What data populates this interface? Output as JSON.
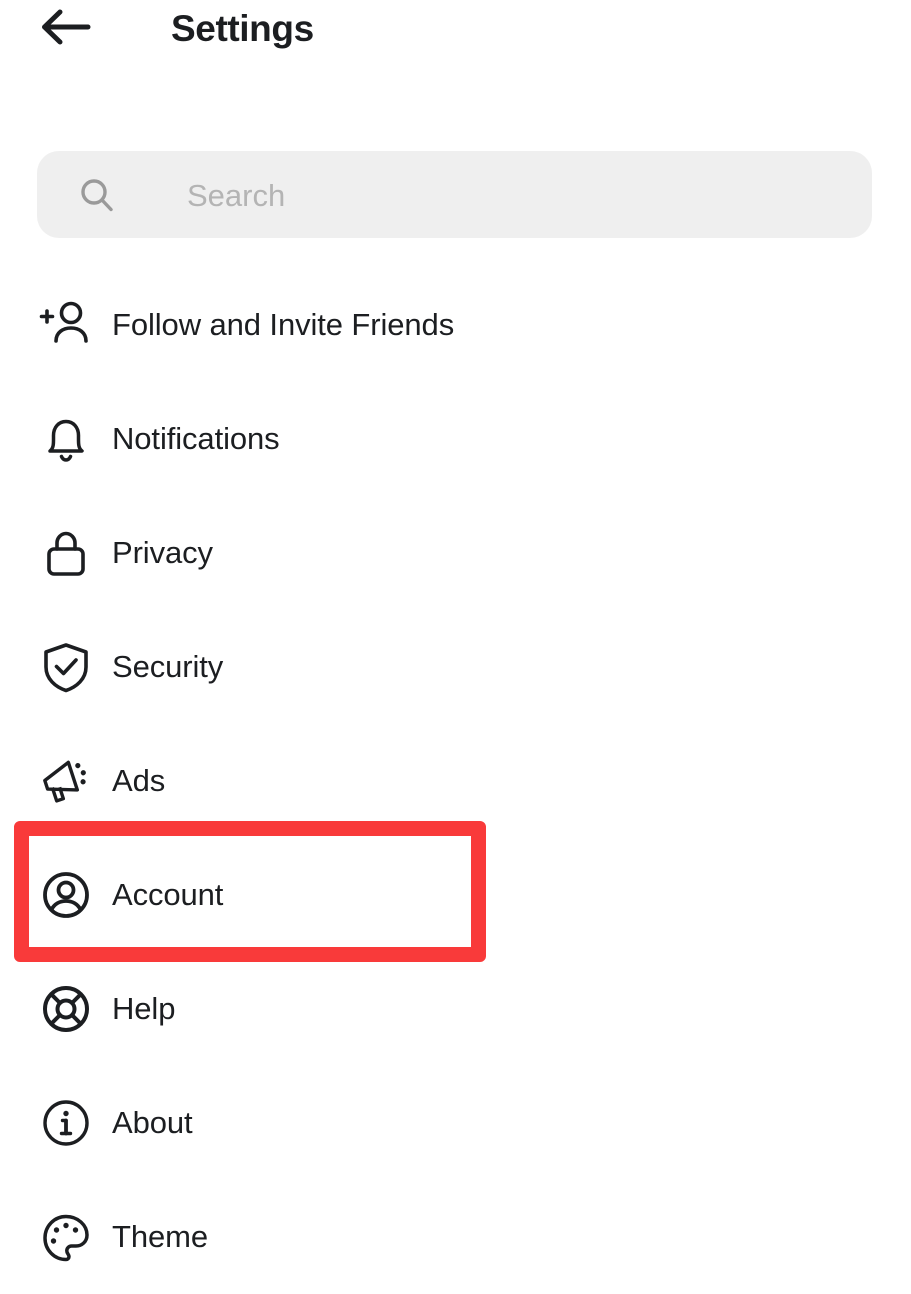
{
  "header": {
    "title": "Settings",
    "back_icon": "arrow-left-icon"
  },
  "search": {
    "placeholder": "Search",
    "value": "",
    "icon": "search-icon",
    "background_color": "#EFEFEF",
    "placeholder_color": "#B4B4B4"
  },
  "menu": {
    "items": [
      {
        "label": "Follow and Invite Friends",
        "icon": "person-add-icon"
      },
      {
        "label": "Notifications",
        "icon": "bell-icon"
      },
      {
        "label": "Privacy",
        "icon": "lock-icon"
      },
      {
        "label": "Security",
        "icon": "shield-check-icon"
      },
      {
        "label": "Ads",
        "icon": "megaphone-icon"
      },
      {
        "label": "Account",
        "icon": "account-circle-icon"
      },
      {
        "label": "Help",
        "icon": "life-ring-icon"
      },
      {
        "label": "About",
        "icon": "info-circle-icon"
      },
      {
        "label": "Theme",
        "icon": "palette-icon"
      }
    ]
  },
  "highlight": {
    "target_label": "Account",
    "color": "#F93A3A",
    "border_width_px": 15
  },
  "colors": {
    "text": "#1C1E21",
    "background": "#FFFFFF",
    "accent_red": "#F93A3A"
  }
}
